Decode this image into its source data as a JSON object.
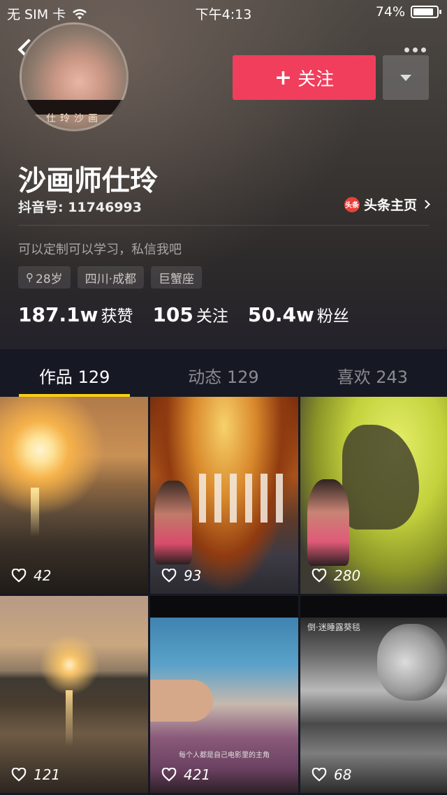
{
  "status_bar": {
    "carrier": "无 SIM 卡",
    "time": "下午4:13",
    "battery": "74%"
  },
  "profile": {
    "avatar_caption": "仕玲沙画",
    "name": "沙画师仕玲",
    "douyin_id": "抖音号: 11746993",
    "toutiao_badge": "头条",
    "toutiao_link": "头条主页",
    "bio": "可以定制可以学习，私信我吧",
    "tags": {
      "age": "28岁",
      "location": "四川·成都",
      "zodiac": "巨蟹座"
    },
    "stats": {
      "likes_num": "187.1w",
      "likes_label": "获赞",
      "following_num": "105",
      "following_label": "关注",
      "followers_num": "50.4w",
      "followers_label": "粉丝"
    }
  },
  "actions": {
    "follow_label": "关注",
    "follow_plus": "+"
  },
  "tabs": [
    {
      "label": "作品 129",
      "active": true
    },
    {
      "label": "动态 129",
      "active": false
    },
    {
      "label": "喜欢 243",
      "active": false
    }
  ],
  "videos": [
    {
      "likes": "42"
    },
    {
      "likes": "93"
    },
    {
      "likes": "280"
    },
    {
      "likes": "121"
    },
    {
      "likes": "421",
      "caption": "每个人都是自己电影里的主角"
    },
    {
      "likes": "68",
      "sign": "倒·迷睡露葵毯"
    }
  ],
  "colors": {
    "accent": "#f13e5c",
    "tab_indicator": "#face15",
    "background": "#161823"
  }
}
